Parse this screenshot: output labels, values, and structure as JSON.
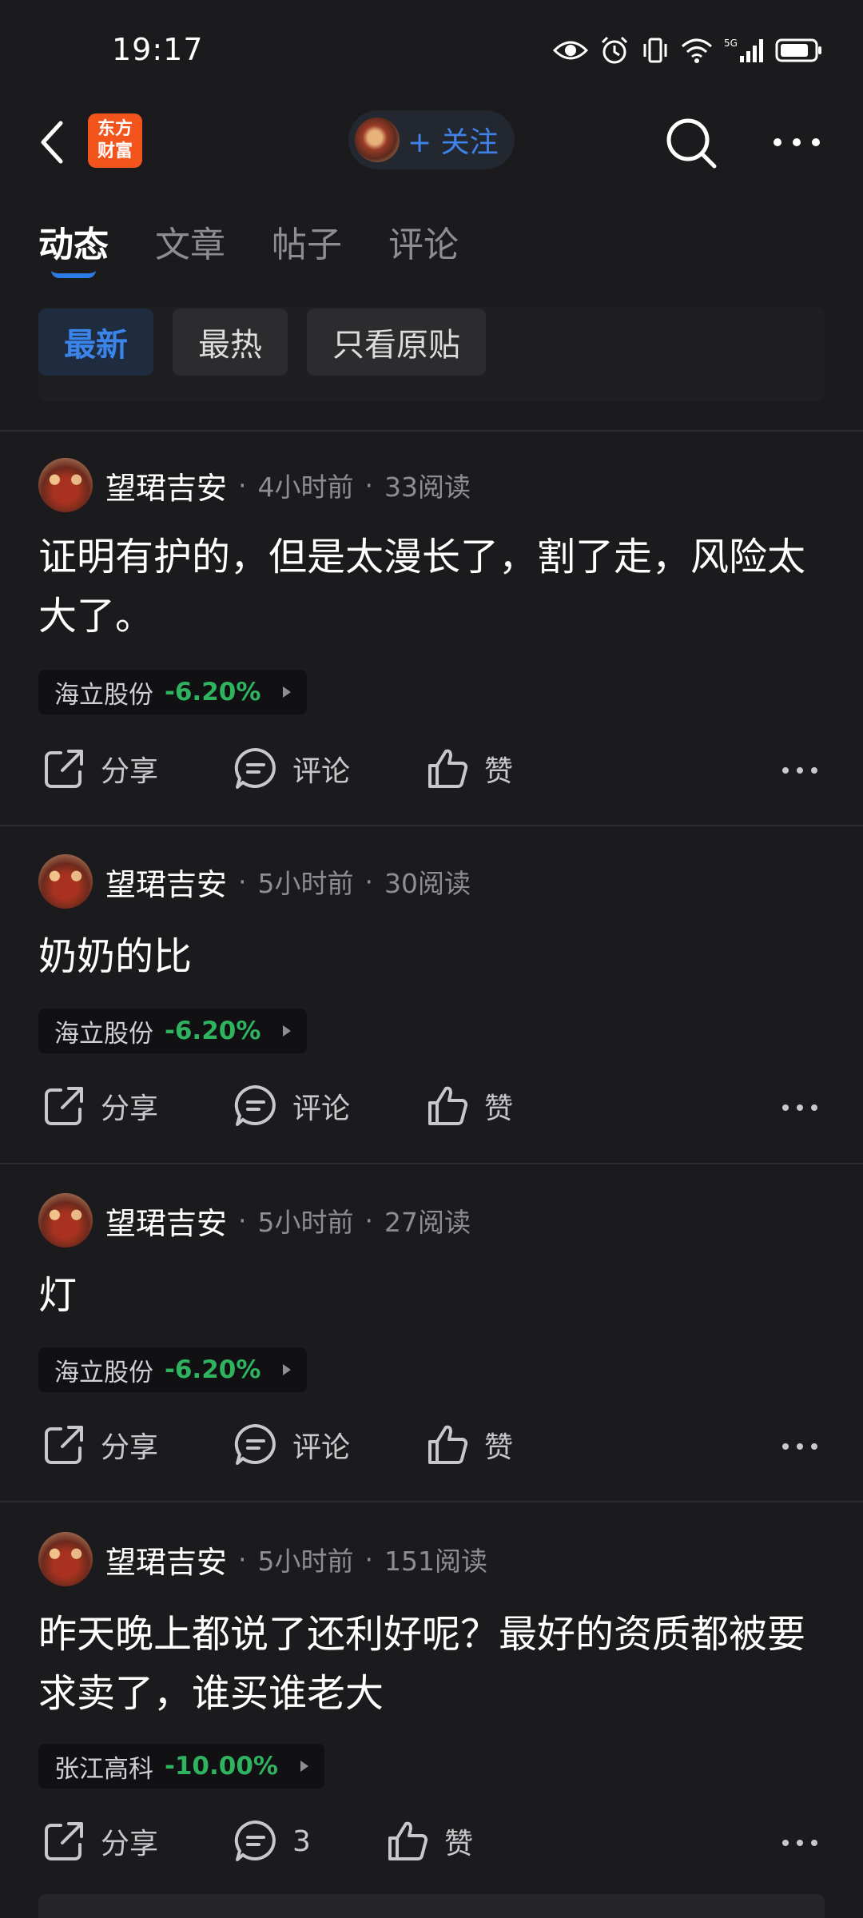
{
  "status_bar": {
    "time": "19:17"
  },
  "header": {
    "logo_line1": "东方",
    "logo_line2": "财富",
    "follow_label": "+ 关注"
  },
  "tabs": [
    {
      "label": "动态"
    },
    {
      "label": "文章"
    },
    {
      "label": "帖子"
    },
    {
      "label": "评论"
    }
  ],
  "filters": [
    {
      "label": "最新"
    },
    {
      "label": "最热"
    },
    {
      "label": "只看原贴"
    }
  ],
  "posts": [
    {
      "author": "望珺吉安",
      "time": "4小时前",
      "reads": "33阅读",
      "text": "证明有护的，但是太漫长了，割了走，风险太大了。",
      "stock_name": "海立股份",
      "stock_change": "-6.20%",
      "share_label": "分享",
      "comment_label": "评论",
      "like_label": "赞"
    },
    {
      "author": "望珺吉安",
      "time": "5小时前",
      "reads": "30阅读",
      "text": "奶奶的比",
      "stock_name": "海立股份",
      "stock_change": "-6.20%",
      "share_label": "分享",
      "comment_label": "评论",
      "like_label": "赞"
    },
    {
      "author": "望珺吉安",
      "time": "5小时前",
      "reads": "27阅读",
      "text": "灯",
      "stock_name": "海立股份",
      "stock_change": "-6.20%",
      "share_label": "分享",
      "comment_label": "评论",
      "like_label": "赞"
    },
    {
      "author": "望珺吉安",
      "time": "5小时前",
      "reads": "151阅读",
      "text": "昨天晚上都说了还利好呢？最好的资质都被要求卖了，谁买谁老大",
      "stock_name": "张江高科",
      "stock_change": "-10.00%",
      "share_label": "分享",
      "comment_label": "3",
      "like_label": "赞"
    }
  ],
  "colors": {
    "background": "#1b1b1d",
    "accent": "#2d7be5",
    "stock_down": "#2fb35f",
    "logo": "#f2541b"
  }
}
